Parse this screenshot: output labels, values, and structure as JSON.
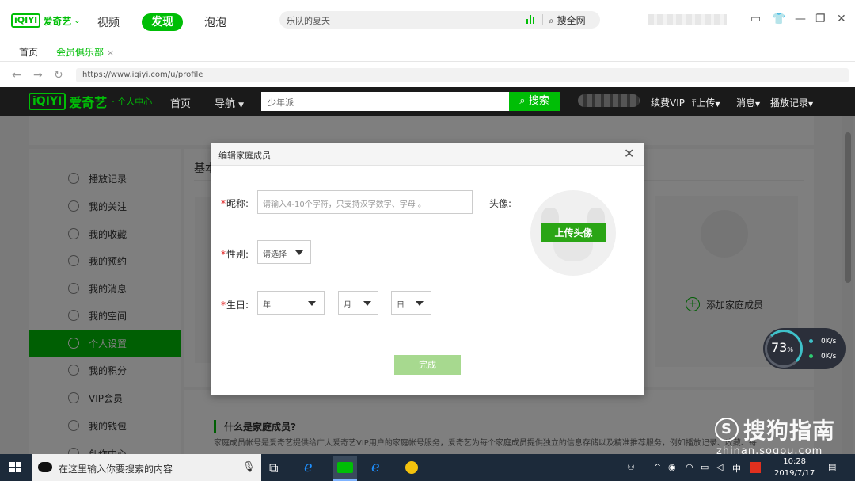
{
  "appbar": {
    "logo_box": "iQIYI",
    "logo_text": "爱奇艺",
    "tabs": [
      "视频",
      "发现",
      "泡泡"
    ],
    "active_tab": "发现",
    "search_query": "乐队的夏天",
    "search_button": "搜全网"
  },
  "tabstrip": {
    "home": "首页",
    "club": "会员俱乐部",
    "close": "×"
  },
  "address": {
    "url": "https://www.iqiyi.com/u/profile"
  },
  "pageheader": {
    "logo_box": "iQIYI",
    "logo_name": "爱奇艺",
    "logo_sub": "· 个人中心",
    "home": "首页",
    "nav": "导航",
    "search_query": "少年派",
    "search_button": "搜索",
    "vip": "续费VIP",
    "upload": "上传",
    "messages": "消息",
    "history": "播放记录"
  },
  "sidebar": {
    "items": [
      {
        "label": "播放记录",
        "icon": "clock-icon"
      },
      {
        "label": "我的关注",
        "icon": "book-icon"
      },
      {
        "label": "我的收藏",
        "icon": "star-icon"
      },
      {
        "label": "我的预约",
        "icon": "calendar-icon"
      },
      {
        "label": "我的消息",
        "icon": "mail-icon"
      },
      {
        "label": "我的空间",
        "icon": "user-icon"
      },
      {
        "label": "个人设置",
        "icon": "gear-icon"
      },
      {
        "label": "我的积分",
        "icon": "points-icon"
      },
      {
        "label": "VIP会员",
        "icon": "vip-icon"
      },
      {
        "label": "我的钱包",
        "icon": "wallet-icon"
      },
      {
        "label": "创作中心",
        "icon": "bulb-icon"
      }
    ],
    "active_index": 6
  },
  "main": {
    "title_partial": "基本",
    "add_member": "添加家庭成员",
    "info_question": "什么是家庭成员?",
    "info_desc": "家庭成员帐号是爱奇艺提供给广大爱奇艺VIP用户的家庭帐号服务，爱奇艺为每个家庭成员提供独立的信息存储以及精准推荐服务，例如播放记录、收藏、每"
  },
  "modal": {
    "title": "编辑家庭成员",
    "nickname_label": "昵称:",
    "nickname_placeholder": "请输入4-10个字符，只支持汉字数字、字母 。",
    "avatar_label": "头像:",
    "upload_button": "上传头像",
    "gender_label": "性别:",
    "gender_value": "请选择",
    "birthday_label": "生日:",
    "year": "年",
    "month": "月",
    "day": "日",
    "done_button": "完成",
    "required_mark": "*"
  },
  "netwidget": {
    "percent": "73",
    "percent_sign": "%",
    "upload_speed": "0K/s",
    "download_speed": "0K/s"
  },
  "watermark": {
    "brand": "搜狗指南",
    "site": "zhinan.sogou.com"
  },
  "taskbar": {
    "search_placeholder": "在这里输入你要搜索的内容",
    "ime": "中",
    "time": "10:28",
    "date": "2019/7/17"
  },
  "colors": {
    "brand_green": "#00be06",
    "active_green": "#2aa515",
    "required_red": "#e02020"
  }
}
